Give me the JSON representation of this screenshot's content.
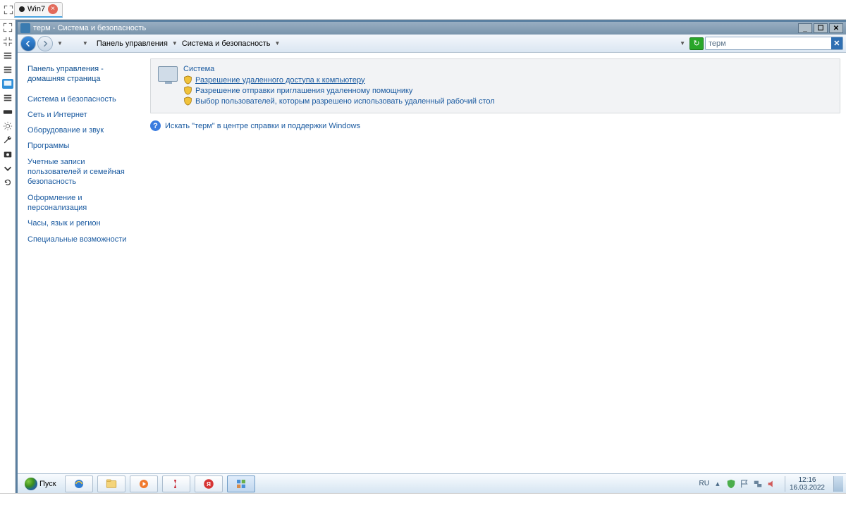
{
  "host": {
    "tab_label": "Win7"
  },
  "window": {
    "title": "терм - Система и безопасность"
  },
  "breadcrumb": {
    "seg1": "Панель управления",
    "seg2": "Система и безопасность"
  },
  "search": {
    "value": "терм"
  },
  "left_nav": {
    "home": "Панель управления - домашняя страница",
    "items": [
      "Система и безопасность",
      "Сеть и Интернет",
      "Оборудование и звук",
      "Программы",
      "Учетные записи пользователей и семейная безопасность",
      "Оформление и персонализация",
      "Часы, язык и регион",
      "Специальные возможности"
    ]
  },
  "result": {
    "title": "Система",
    "links": [
      "Разрешение удаленного доступа к компьютеру",
      "Разрешение отправки приглашения удаленному помощнику",
      "Выбор пользователей, которым разрешено использовать удаленный рабочий стол"
    ]
  },
  "help_line": "Искать \"терм\" в центре справки и поддержки Windows",
  "taskbar": {
    "start": "Пуск",
    "lang": "RU",
    "time": "12:16",
    "date": "16.03.2022"
  }
}
